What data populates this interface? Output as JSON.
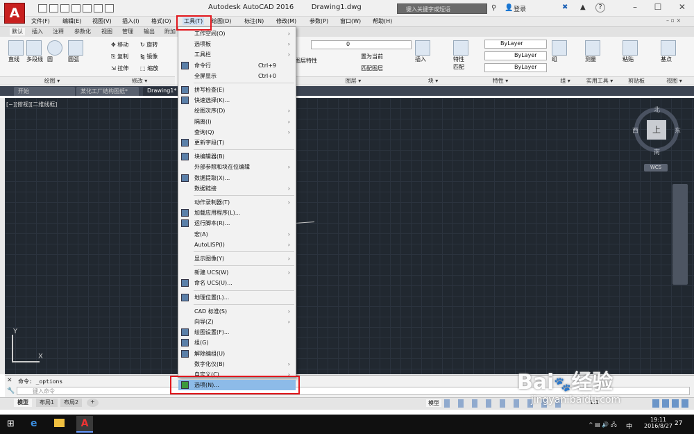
{
  "app": {
    "title": "Autodesk AutoCAD 2016",
    "document": "Drawing1.dwg",
    "logo": "A",
    "search_placeholder": "键入关键字或短语",
    "login": "登录",
    "window_controls": [
      "–",
      "☐",
      "✕"
    ]
  },
  "menubar": [
    "文件(F)",
    "编辑(E)",
    "视图(V)",
    "插入(I)",
    "格式(O)",
    "工具(T)",
    "绘图(D)",
    "标注(N)",
    "修改(M)",
    "参数(P)",
    "窗口(W)",
    "帮助(H)"
  ],
  "ribbon_tabs": [
    "默认",
    "插入",
    "注释",
    "参数化",
    "视图",
    "管理",
    "输出",
    "附加"
  ],
  "ribbon": {
    "draw_buttons": [
      "直线",
      "多段线",
      "圆",
      "圆弧"
    ],
    "modify_buttons": [
      "移动",
      "旋转",
      "复制",
      "镜像",
      "拉伸",
      "缩放"
    ],
    "layer_combo": "0",
    "layer_buttons": [
      "图层特性",
      "置为当前",
      "匹配图层"
    ],
    "block_button": "插入",
    "property_match": "特性匹配",
    "bylayer": [
      "ByLayer",
      "ByLayer",
      "ByLayer"
    ],
    "group_button": "组",
    "measure_button": "测量",
    "paste_button": "粘贴",
    "base_button": "基点",
    "group_labels": [
      "绘图 ▾",
      "修改 ▾",
      "图层 ▾",
      "块 ▾",
      "特性 ▾",
      "组 ▾",
      "实用工具 ▾",
      "剪贴板",
      "视图 ▾"
    ]
  },
  "file_tabs": [
    "开始",
    "某化工厂结构图纸*",
    "Drawing1*"
  ],
  "viewport": {
    "label": "[−][俯视][二维线框]",
    "compass": {
      "north": "北",
      "south": "南",
      "east": "东",
      "west": "西",
      "top": "上"
    },
    "wcs": "WCS",
    "ucs_x": "X",
    "ucs_y": "Y"
  },
  "tools_menu": {
    "items": [
      {
        "label": "工作空间(O)",
        "arrow": true
      },
      {
        "label": "选项板",
        "arrow": true
      },
      {
        "label": "工具栏",
        "arrow": true
      },
      {
        "label": "命令行",
        "shortcut": "Ctrl+9",
        "icon": "command-line-icon"
      },
      {
        "label": "全屏显示",
        "shortcut": "Ctrl+0"
      },
      {
        "sep": true
      },
      {
        "label": "拼写检查(E)",
        "icon": "spell-check-icon"
      },
      {
        "label": "快速选择(K)...",
        "icon": "quick-select-icon"
      },
      {
        "label": "绘图次序(D)",
        "arrow": true
      },
      {
        "label": "隔离(I)",
        "arrow": true
      },
      {
        "label": "查询(Q)",
        "arrow": true
      },
      {
        "label": "更新字段(T)",
        "icon": "update-field-icon"
      },
      {
        "sep": true
      },
      {
        "label": "块编辑器(B)",
        "icon": "block-editor-icon"
      },
      {
        "label": "外部参照和块在位编辑",
        "arrow": true
      },
      {
        "label": "数据提取(X)...",
        "icon": "data-extract-icon"
      },
      {
        "label": "数据链接",
        "arrow": true
      },
      {
        "sep": true
      },
      {
        "label": "动作录制器(T)",
        "arrow": true
      },
      {
        "label": "加载应用程序(L)...",
        "icon": "load-app-icon"
      },
      {
        "label": "运行脚本(R)...",
        "icon": "run-script-icon"
      },
      {
        "label": "宏(A)",
        "arrow": true
      },
      {
        "label": "AutoLISP(I)",
        "arrow": true
      },
      {
        "sep": true
      },
      {
        "label": "显示图像(Y)",
        "arrow": true
      },
      {
        "sep": true
      },
      {
        "label": "新建 UCS(W)",
        "arrow": true
      },
      {
        "label": "命名 UCS(U)...",
        "icon": "named-ucs-icon"
      },
      {
        "sep": true
      },
      {
        "label": "地理位置(L)...",
        "icon": "geo-location-icon"
      },
      {
        "sep": true
      },
      {
        "label": "CAD 标准(S)",
        "arrow": true
      },
      {
        "label": "向导(Z)",
        "arrow": true
      },
      {
        "label": "绘图设置(F)...",
        "icon": "drafting-settings-icon"
      },
      {
        "label": "组(G)",
        "icon": "group-icon"
      },
      {
        "label": "解除编组(U)",
        "icon": "ungroup-icon"
      },
      {
        "label": "数字化仪(B)",
        "arrow": true
      },
      {
        "label": "自定义(C)",
        "arrow": true
      },
      {
        "label": "选项(N)...",
        "icon": "options-icon",
        "highlight": true
      }
    ]
  },
  "command": {
    "history": "命令: _options",
    "placeholder": "键入命令"
  },
  "layout_tabs": [
    "模型",
    "布局1",
    "布局2",
    "+"
  ],
  "status": {
    "model": "模型",
    "scale": "1:1"
  },
  "taskbar": {
    "time": "19:11",
    "date": "2016/8/27",
    "lang": "中",
    "notify": "27"
  },
  "watermark": {
    "brand": "Bai",
    "brand2": "经验",
    "site": "jingyan.baidu.com"
  }
}
